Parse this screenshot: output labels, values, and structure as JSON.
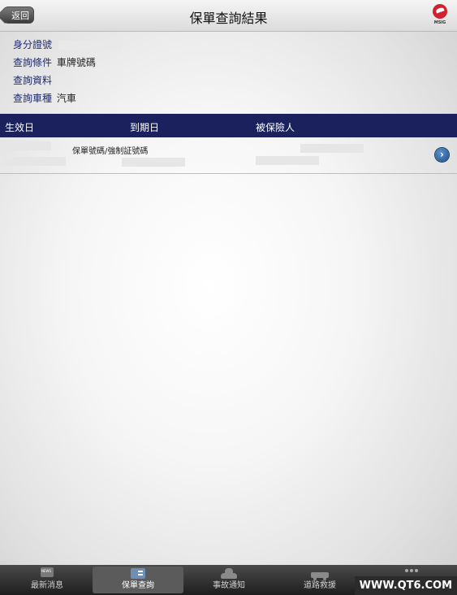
{
  "header": {
    "back_label": "返回",
    "title": "保單查詢結果",
    "logo_text": "MSIG"
  },
  "query_info": {
    "rows": [
      {
        "label": "身分證號",
        "value": ""
      },
      {
        "label": "查詢條件",
        "value": "車牌號碼"
      },
      {
        "label": "查詢資料",
        "value": ""
      },
      {
        "label": "查詢車種",
        "value": "汽車"
      }
    ]
  },
  "table": {
    "columns": [
      "生效日",
      "到期日",
      "被保險人"
    ],
    "rows": [
      {
        "policy_label": "保單號碼/強制証號碼"
      }
    ]
  },
  "tabbar": {
    "items": [
      {
        "label": "最新消息",
        "icon": "news-icon",
        "active": false
      },
      {
        "label": "保單查詢",
        "icon": "policy-card-icon",
        "active": true
      },
      {
        "label": "事故通知",
        "icon": "accident-car-icon",
        "active": false
      },
      {
        "label": "道路救援",
        "icon": "tow-truck-icon",
        "active": false
      },
      {
        "label": "",
        "icon": "more-icon",
        "active": false
      }
    ]
  },
  "watermark": "WWW.QT6.COM",
  "colors": {
    "table_header_bg": "#1b215c",
    "label_text": "#1f2b6e",
    "logo_red": "#d1202e"
  }
}
